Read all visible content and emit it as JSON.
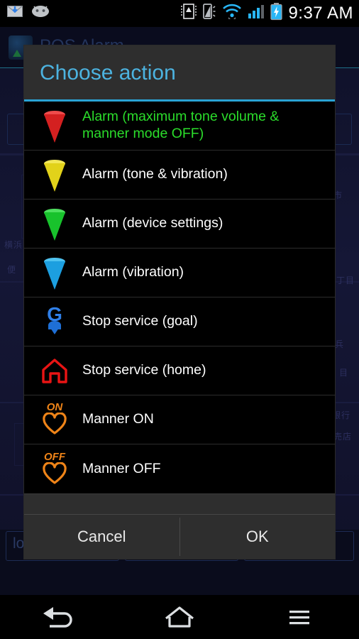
{
  "status_bar": {
    "time": "9:37 AM",
    "left_icons": [
      {
        "name": "email-download-icon"
      },
      {
        "name": "android-head-icon"
      }
    ],
    "right_icons": [
      {
        "name": "vibrate-alert-icon"
      },
      {
        "name": "ringer-vibration-icon"
      },
      {
        "name": "wifi-icon"
      },
      {
        "name": "cellular-signal-icon"
      },
      {
        "name": "battery-charging-icon"
      }
    ],
    "colors": {
      "accent": "#29b6f6",
      "text": "#ffffff"
    }
  },
  "background_app": {
    "title": "POS Alarm",
    "bottom_label": "location",
    "map_labels": [
      "横浜",
      "市",
      "丁目",
      "兵",
      "目",
      "銀行",
      "売店",
      "便"
    ]
  },
  "dialog": {
    "title": "Choose action",
    "title_color": "#4cb3e0",
    "divider_color": "#2aa3d4",
    "highlight_color": "#2bdd2b",
    "items": [
      {
        "label": "Alarm (maximum tone volume & manner mode OFF)",
        "icon": "cone-marker-red-icon",
        "icon_color": "#d42020",
        "selected": true
      },
      {
        "label": "Alarm (tone & vibration)",
        "icon": "cone-marker-yellow-icon",
        "icon_color": "#e2d21a",
        "selected": false
      },
      {
        "label": "Alarm (device settings)",
        "icon": "cone-marker-green-icon",
        "icon_color": "#18c22c",
        "selected": false
      },
      {
        "label": "Alarm (vibration)",
        "icon": "cone-marker-blue-icon",
        "icon_color": "#1c9fe0",
        "selected": false
      },
      {
        "label": "Stop service (goal)",
        "icon": "goal-marker-icon",
        "icon_color": "#2f7fe8",
        "icon_text": "G",
        "selected": false
      },
      {
        "label": "Stop service (home)",
        "icon": "home-marker-icon",
        "icon_color": "#e81414",
        "selected": false
      },
      {
        "label": "Manner ON",
        "icon": "manner-heart-on-icon",
        "icon_color": "#ef8418",
        "icon_text": "ON",
        "selected": false
      },
      {
        "label": "Manner OFF",
        "icon": "manner-heart-off-icon",
        "icon_color": "#ef8418",
        "icon_text": "OFF",
        "selected": false
      }
    ],
    "buttons": {
      "cancel": "Cancel",
      "ok": "OK"
    }
  },
  "nav_bar": {
    "back": "back-icon",
    "home": "home-icon",
    "menu": "menu-icon"
  }
}
